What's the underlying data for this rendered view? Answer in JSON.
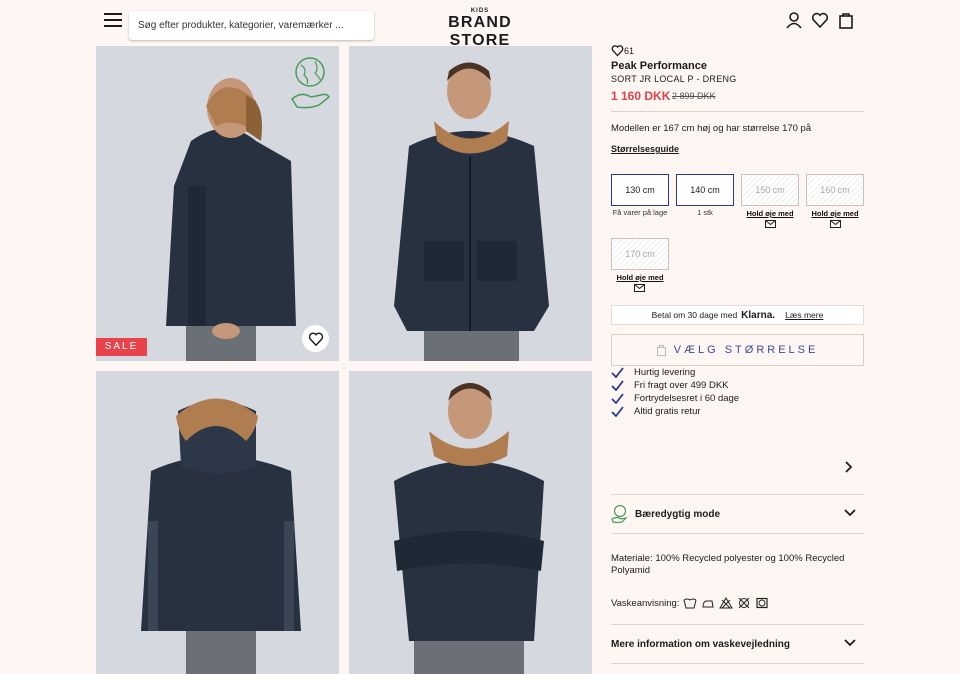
{
  "header": {
    "search_placeholder": "Søg efter produkter, kategorier, varemærker ...",
    "logo_top": "KIDS",
    "logo_main": "BRAND STORE"
  },
  "gallery": {
    "sale_label": "SALE"
  },
  "product": {
    "likes": "61",
    "brand": "Peak Performance",
    "name": "SORT JR LOCAL P - DRENG",
    "price": "1 160 DKK",
    "old_price": "2 899 DKK",
    "model_text": "Modellen er 167 cm høj og har størrelse 170 på",
    "size_guide": "Størrelsesguide"
  },
  "sizes": [
    {
      "label": "130 cm",
      "note": "Få varer på lage",
      "available": true
    },
    {
      "label": "140 cm",
      "note": "1 stk",
      "available": true
    },
    {
      "label": "150 cm",
      "note": "Hold øje med",
      "available": false
    },
    {
      "label": "160 cm",
      "note": "Hold øje med",
      "available": false
    },
    {
      "label": "170 cm",
      "note": "Hold øje med",
      "available": false
    }
  ],
  "klarna": {
    "text": "Betal om 30 dage med",
    "brand": "Klarna.",
    "more": "Læs mere"
  },
  "choose_size_label": "VÆLG STØRRELSE",
  "usps": [
    "Hurtig levering",
    "Fri fragt over 499 DKK",
    "Fortrydelsesret i 60 dage",
    "Altid gratis retur"
  ],
  "accordions": {
    "sustainable": "Bæredygtig mode",
    "more_info": "Mere information om vaskevejledning"
  },
  "material": "Materiale: 100% Recycled polyester og 100% Recycled Polyamid",
  "wash_label": "Vaskeanvisning:",
  "colors": {
    "background": "#fdf6f3",
    "price_red": "#e0404a",
    "accent_blue": "#2a3a8c",
    "sale_red": "#e8424a",
    "eco_green": "#4a9a5a"
  }
}
